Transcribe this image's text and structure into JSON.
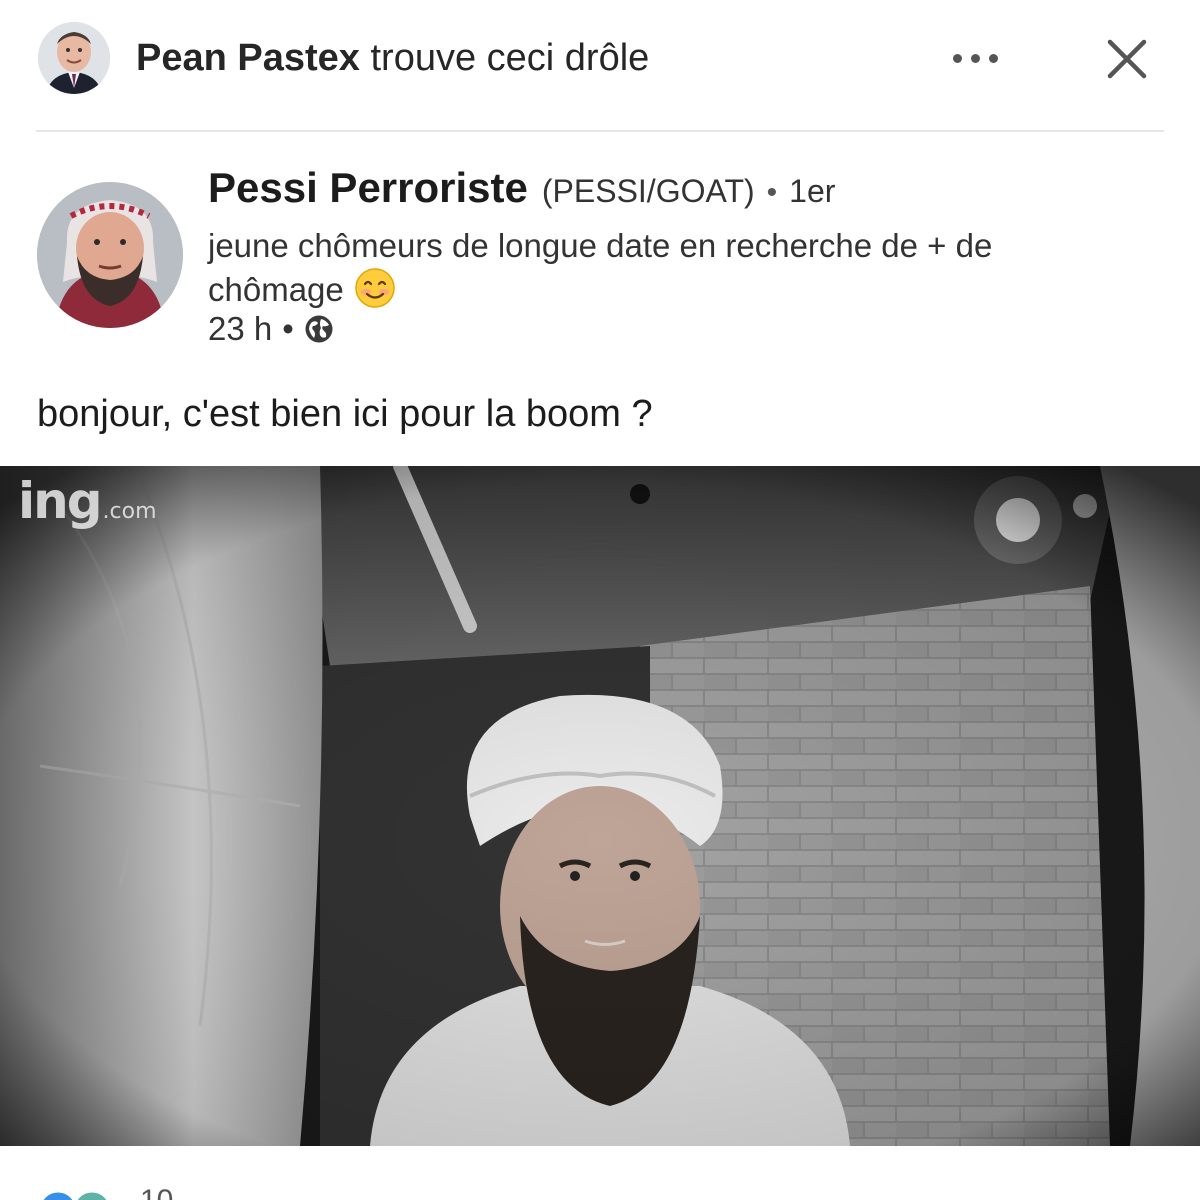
{
  "activity": {
    "actor": "Pean Pastex",
    "action": "trouve ceci drôle",
    "more_icon": "more-horizontal-icon",
    "close_icon": "close-icon"
  },
  "post": {
    "author": {
      "name": "Pessi Perroriste",
      "handle": "(PESSI/GOAT)",
      "separator": "•",
      "degree": "1er",
      "headline": "jeune chômeurs de longue date en recherche de + de chômage",
      "headline_emoji": "smiling-face-icon"
    },
    "meta": {
      "time": "23 h",
      "separator": "•",
      "visibility_icon": "globe-icon"
    },
    "text": "bonjour, c'est bien ici pour la boom ?",
    "image": {
      "watermark": "ing",
      "watermark_suffix": ".com"
    }
  },
  "reactions": {
    "count": "10"
  }
}
